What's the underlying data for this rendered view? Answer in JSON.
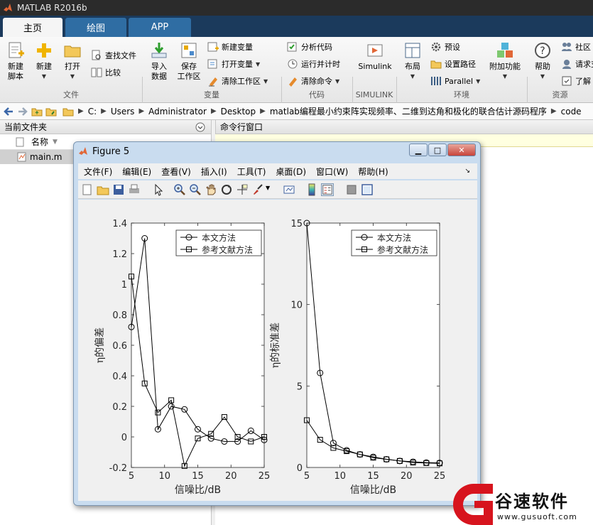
{
  "app": {
    "title": "MATLAB R2016b"
  },
  "tabs": [
    {
      "label": "主页"
    },
    {
      "label": "绘图"
    },
    {
      "label": "APP"
    }
  ],
  "ribbon": {
    "new_script": "新建\n脚本",
    "new": "新建",
    "open": "打开",
    "find_files": "查找文件",
    "compare": "比较",
    "import_data": "导入\n数据",
    "save_workspace": "保存\n工作区",
    "new_variable": "新建变量",
    "open_variable": "打开变量",
    "clear_workspace": "清除工作区",
    "analyze_code": "分析代码",
    "run_and_time": "运行并计时",
    "clear_commands": "清除命令",
    "simulink": "Simulink",
    "layout": "布局",
    "preferences": "预设",
    "set_path": "设置路径",
    "parallel": "Parallel",
    "addons": "附加功能",
    "help": "帮助",
    "community": "社区",
    "request_support": "请求支",
    "learn": "了解",
    "groups": {
      "file": "文件",
      "variable": "变量",
      "code": "代码",
      "simulink": "SIMULINK",
      "environment": "环境",
      "resources": "资源"
    }
  },
  "path": [
    "C:",
    "Users",
    "Administrator",
    "Desktop",
    "matlab编程最小约束阵实现频率、二维到达角和极化的联合估计源码程序",
    "code"
  ],
  "left_panel": {
    "title": "当前文件夹",
    "col_name": "名称",
    "files": [
      "main.m"
    ]
  },
  "cmd_panel": {
    "title": "命令行窗口"
  },
  "figure": {
    "title": "Figure 5",
    "menu": [
      "文件(F)",
      "编辑(E)",
      "查看(V)",
      "插入(I)",
      "工具(T)",
      "桌面(D)",
      "窗口(W)",
      "帮助(H)"
    ]
  },
  "chart_data": [
    {
      "type": "line",
      "xlabel": "信噪比/dB",
      "ylabel": "η的偏差",
      "xlim": [
        5,
        25
      ],
      "ylim": [
        -0.2,
        1.4
      ],
      "xticks": [
        5,
        10,
        15,
        20,
        25
      ],
      "yticks": [
        -0.2,
        0,
        0.2,
        0.4,
        0.6,
        0.8,
        1,
        1.2,
        1.4
      ],
      "ytick_labels": [
        "-0.2",
        "0",
        "0.2",
        "0.4",
        "0.6",
        "0.8",
        "1",
        "1.2",
        "1.4"
      ],
      "legend": "top-right",
      "x": [
        5,
        7,
        9,
        11,
        13,
        15,
        17,
        19,
        21,
        23,
        25
      ],
      "series": [
        {
          "name": "本文方法",
          "marker": "circle",
          "values": [
            0.72,
            1.3,
            0.05,
            0.2,
            0.18,
            0.05,
            -0.01,
            -0.03,
            -0.03,
            0.04,
            -0.02
          ]
        },
        {
          "name": "参考文献方法",
          "marker": "square",
          "values": [
            1.05,
            0.35,
            0.16,
            0.24,
            -0.19,
            -0.01,
            0.02,
            0.13,
            0.0,
            -0.03,
            0.0
          ]
        }
      ]
    },
    {
      "type": "line",
      "xlabel": "信噪比/dB",
      "ylabel": "η的标准差",
      "xlim": [
        5,
        25
      ],
      "ylim": [
        0,
        15
      ],
      "xticks": [
        5,
        10,
        15,
        20,
        25
      ],
      "yticks": [
        0,
        5,
        10,
        15
      ],
      "ytick_labels": [
        "0",
        "5",
        "10",
        "15"
      ],
      "legend": "top-right",
      "x": [
        5,
        7,
        9,
        11,
        13,
        15,
        17,
        19,
        21,
        23,
        25
      ],
      "series": [
        {
          "name": "本文方法",
          "marker": "circle",
          "values": [
            15.0,
            5.8,
            1.5,
            1.05,
            0.8,
            0.65,
            0.5,
            0.4,
            0.35,
            0.3,
            0.28
          ]
        },
        {
          "name": "参考文献方法",
          "marker": "square",
          "values": [
            2.9,
            1.7,
            1.2,
            1.0,
            0.8,
            0.6,
            0.5,
            0.4,
            0.3,
            0.27,
            0.25
          ]
        }
      ]
    }
  ],
  "watermark": {
    "name": "谷速软件",
    "url": "www.gusuoft.com",
    "logo_text": "G"
  },
  "colors": {
    "matlab_orange": "#e16737",
    "tab_blue": "#2f6da3",
    "watermark_red": "#d7141e"
  }
}
